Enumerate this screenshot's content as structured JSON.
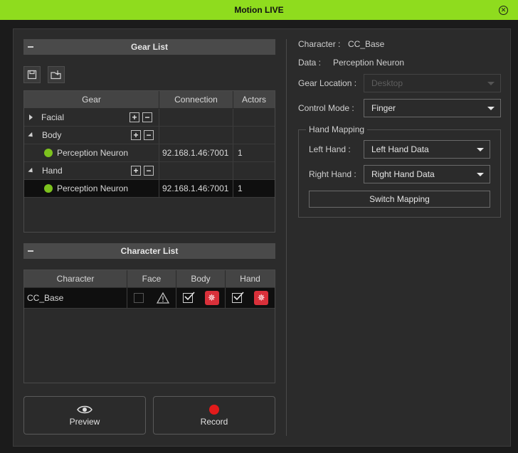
{
  "window": {
    "title": "Motion LIVE"
  },
  "gear_list": {
    "title": "Gear List",
    "columns": [
      "Gear",
      "Connection",
      "Actors"
    ],
    "rows": [
      {
        "name": "Facial",
        "connection": "",
        "actors": ""
      },
      {
        "name": "Body",
        "connection": "",
        "actors": ""
      },
      {
        "name": "Perception Neuron",
        "connection": "92.168.1.46:7001",
        "actors": "1"
      },
      {
        "name": "Hand",
        "connection": "",
        "actors": ""
      },
      {
        "name": "Perception Neuron",
        "connection": "92.168.1.46:7001",
        "actors": "1"
      }
    ],
    "plus": "+",
    "minus": "−"
  },
  "character_list": {
    "title": "Character List",
    "columns": [
      "Character",
      "Face",
      "Body",
      "Hand"
    ],
    "rows": [
      {
        "character": "CC_Base"
      }
    ]
  },
  "buttons": {
    "preview": "Preview",
    "record": "Record"
  },
  "info": {
    "character_label": "Character :",
    "character_value": "CC_Base",
    "data_label": "Data :",
    "data_value": "Perception Neuron"
  },
  "settings": {
    "gear_location_label": "Gear Location :",
    "gear_location_value": "Desktop",
    "control_mode_label": "Control Mode :",
    "control_mode_value": "Finger"
  },
  "hand_mapping": {
    "title": "Hand Mapping",
    "left_label": "Left Hand :",
    "left_value": "Left Hand Data",
    "right_label": "Right Hand :",
    "right_value": "Right Hand Data",
    "switch_label": "Switch Mapping"
  },
  "colors": {
    "accent": "#8fdc1e",
    "status_ok": "#7dc21e",
    "record": "#e21b1b",
    "warning_badge": "#d9303a"
  }
}
